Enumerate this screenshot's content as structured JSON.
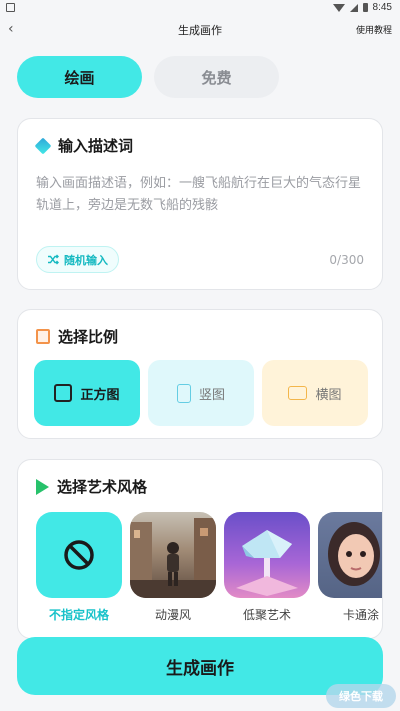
{
  "status_bar": {
    "time": "8:45"
  },
  "nav": {
    "back_glyph": "‹",
    "title": "生成画作",
    "help_link": "使用教程"
  },
  "tabs": [
    {
      "label": "绘画",
      "active": true
    },
    {
      "label": "免费",
      "active": false
    }
  ],
  "prompt_card": {
    "title": "输入描述词",
    "placeholder": "输入画面描述语，例如：一艘飞船航行在巨大的气态行星轨道上，旁边是无数飞船的残骸",
    "random_label": "随机输入",
    "random_icon": "shuffle-icon",
    "counter": "0/300"
  },
  "ratio_card": {
    "title": "选择比例",
    "options": [
      {
        "label": "正方图",
        "selected": true
      },
      {
        "label": "竖图",
        "selected": false
      },
      {
        "label": "横图",
        "selected": false
      }
    ]
  },
  "style_card": {
    "title": "选择艺术风格",
    "styles": [
      {
        "label": "不指定风格",
        "selected": true
      },
      {
        "label": "动漫风",
        "selected": false
      },
      {
        "label": "低聚艺术",
        "selected": false
      },
      {
        "label": "卡通涂",
        "selected": false
      }
    ]
  },
  "cta": {
    "label": "生成画作"
  },
  "watermark": {
    "text": "绿色下载"
  },
  "colors": {
    "accent": "#42e8e6",
    "selected_text": "#17c2c9"
  }
}
